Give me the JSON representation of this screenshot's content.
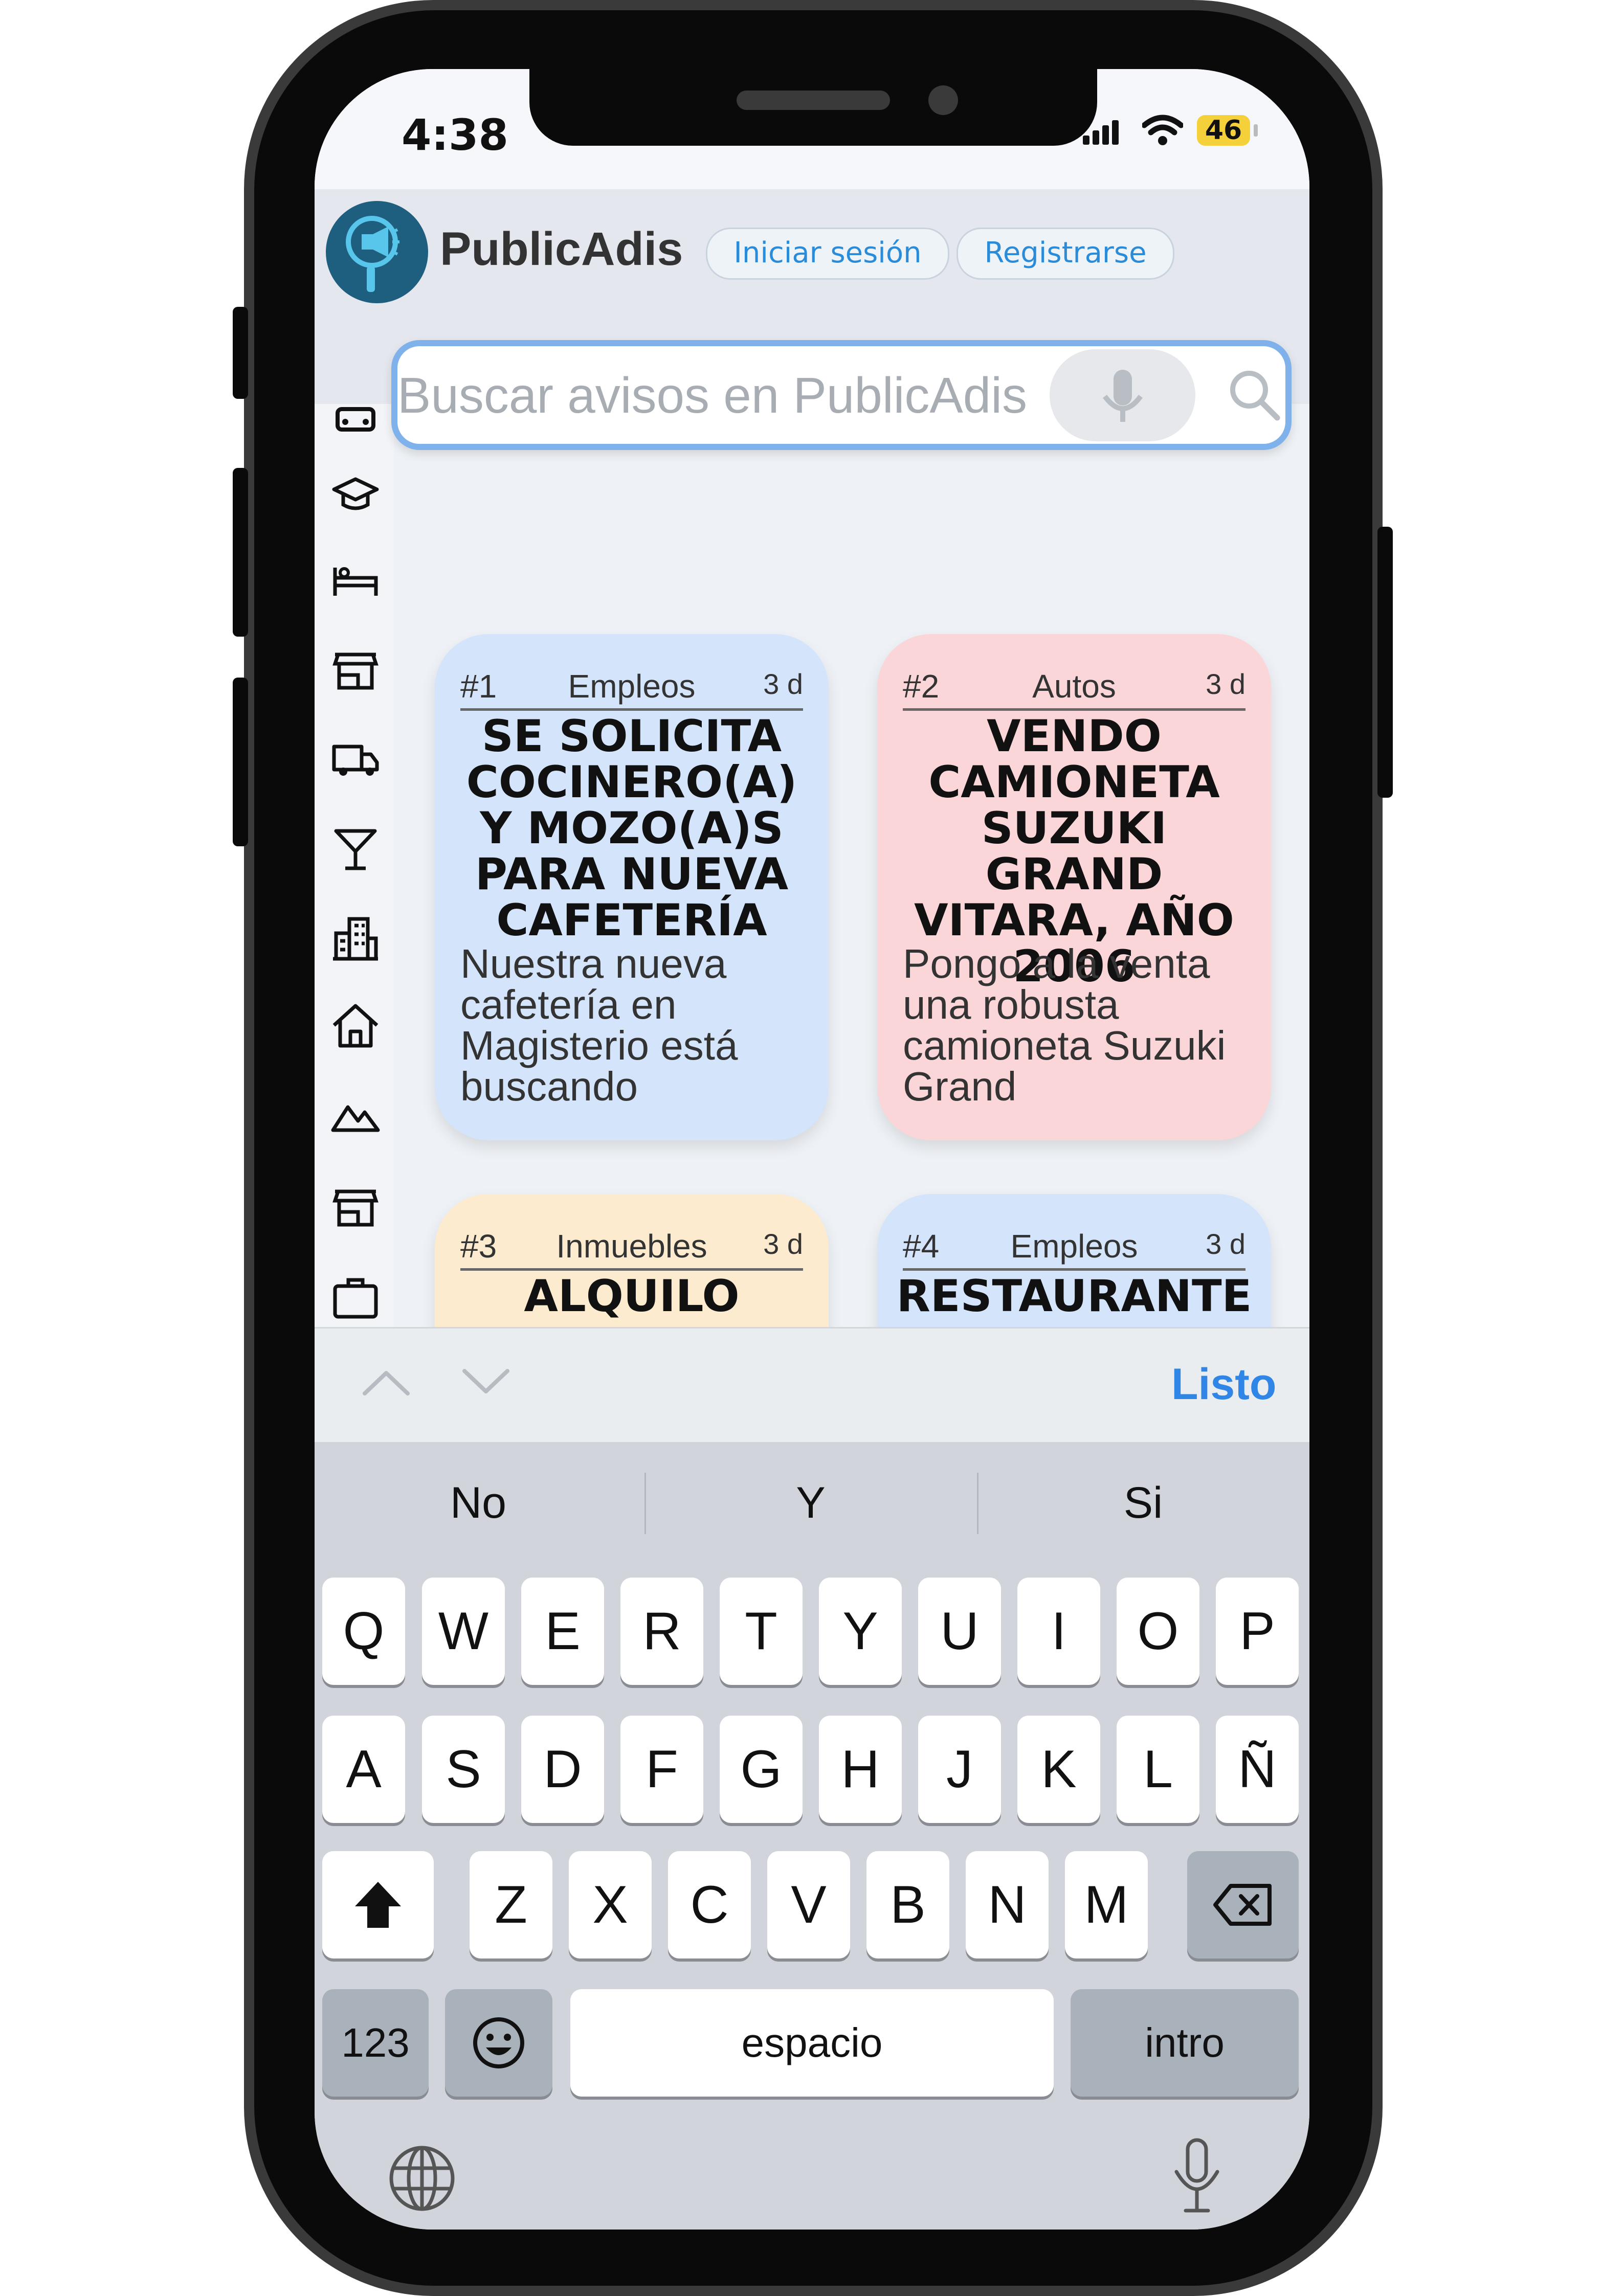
{
  "status_bar": {
    "time": "4:38",
    "battery": "46"
  },
  "header": {
    "brand": "PublicAdis",
    "login_label": "Iniciar sesión",
    "register_label": "Registrarse"
  },
  "search": {
    "placeholder": "Buscar avisos en PublicAdis"
  },
  "sidebar": {
    "icons": [
      "car-icon",
      "graduation-cap-icon",
      "bed-icon",
      "store-icon",
      "truck-icon",
      "cocktail-icon",
      "buildings-icon",
      "house-icon",
      "mountain-icon",
      "store-icon",
      "briefcase-icon"
    ]
  },
  "cards": [
    {
      "number": "#1",
      "category": "Empleos",
      "age": "3 d",
      "title": "SE SOLICITA COCINERO(A) Y MOZO(A)S PARA NUEVA CAFETERÍA",
      "body": "Nuestra nueva cafetería en Magisterio está buscando",
      "color": "#d3e4fb"
    },
    {
      "number": "#2",
      "category": "Autos",
      "age": "3 d",
      "title": "VENDO CAMIONETA SUZUKI GRAND VITARA, AÑO 2006",
      "body": "Pongo a la venta una robusta camioneta Suzuki Grand",
      "color": "#fbd6d8"
    },
    {
      "number": "#3",
      "category": "Inmuebles",
      "age": "3 d",
      "title": "ALQUILO",
      "body": "",
      "color": "#fdebcf"
    },
    {
      "number": "#4",
      "category": "Empleos",
      "age": "3 d",
      "title": "RESTAURANTE",
      "body": "",
      "color": "#d3e4fb"
    }
  ],
  "accessory": {
    "done_label": "Listo"
  },
  "keyboard": {
    "suggestions": [
      "No",
      "Y",
      "Si"
    ],
    "row1": [
      "Q",
      "W",
      "E",
      "R",
      "T",
      "Y",
      "U",
      "I",
      "O",
      "P"
    ],
    "row2": [
      "A",
      "S",
      "D",
      "F",
      "G",
      "H",
      "J",
      "K",
      "L",
      "Ñ"
    ],
    "row3": [
      "Z",
      "X",
      "C",
      "V",
      "B",
      "N",
      "M"
    ],
    "numbers_label": "123",
    "space_label": "espacio",
    "return_label": "intro"
  },
  "colors": {
    "accent": "#2f86e6",
    "logo": "#1e5f80",
    "search_border": "#7fb2eb"
  }
}
